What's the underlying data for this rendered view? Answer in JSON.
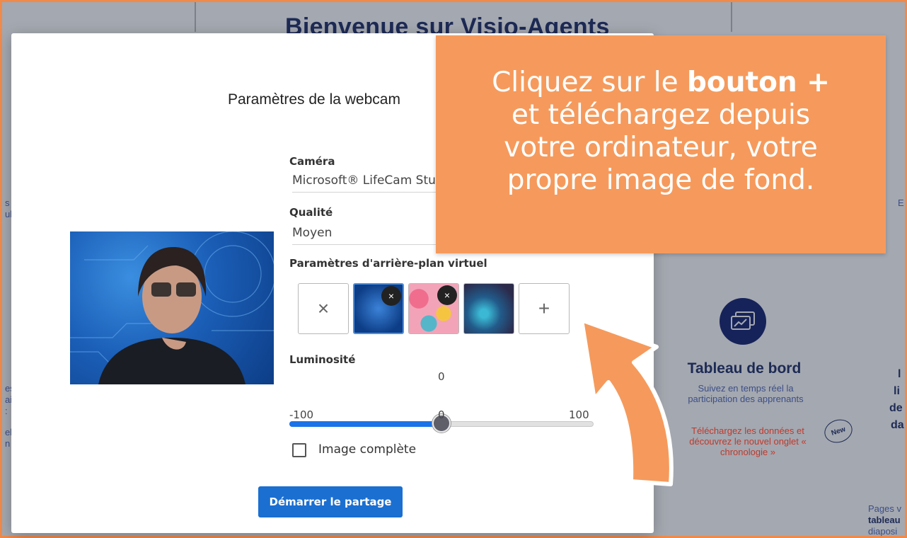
{
  "background": {
    "title": "Bienvenue sur Visio-Agents",
    "card": {
      "title": "Tableau de bord",
      "description": "Suivez en temps réel la participation des apprenants",
      "highlight": "Téléchargez les données et découvrez le nouvel onglet « chronologie »",
      "badge": "New"
    },
    "fragments": {
      "left_a": "s",
      "left_b": "ul",
      "left_c": "es",
      "left_d": "ai",
      "left_e": ":",
      "left_f": "el",
      "left_g": "n",
      "right_a": "E",
      "right_b": "l",
      "right_c": "li",
      "right_d": "de",
      "right_e": "da",
      "bottom_right_1": "Pages v",
      "bottom_right_2": "tableau",
      "bottom_right_3": "diaposi"
    }
  },
  "modal": {
    "title": "Paramètres de la webcam",
    "camera": {
      "label": "Caméra",
      "value": "Microsoft® LifeCam Studio"
    },
    "quality": {
      "label": "Qualité",
      "value": "Moyen"
    },
    "virtual_bg": {
      "label": "Paramètres d'arrière-plan virtuel",
      "none_symbol": "×",
      "remove_symbol": "×",
      "add_symbol": "+"
    },
    "brightness": {
      "label": "Luminosité",
      "value": 0,
      "current": "0",
      "min": "-100",
      "mid": "0",
      "max": "100"
    },
    "full_image": {
      "label": "Image complète",
      "checked": false
    },
    "start_button": "Démarrer le partage"
  },
  "callout": {
    "line1_pre": "Cliquez sur le ",
    "line1_bold": "bouton +",
    "line2": "et téléchargez depuis",
    "line3": "votre ordinateur, votre",
    "line4": "propre image de fond."
  },
  "colors": {
    "accent": "#1a73e8",
    "callout": "#f59a5c",
    "frame": "#f08a4b",
    "navy": "#1d2a55"
  }
}
